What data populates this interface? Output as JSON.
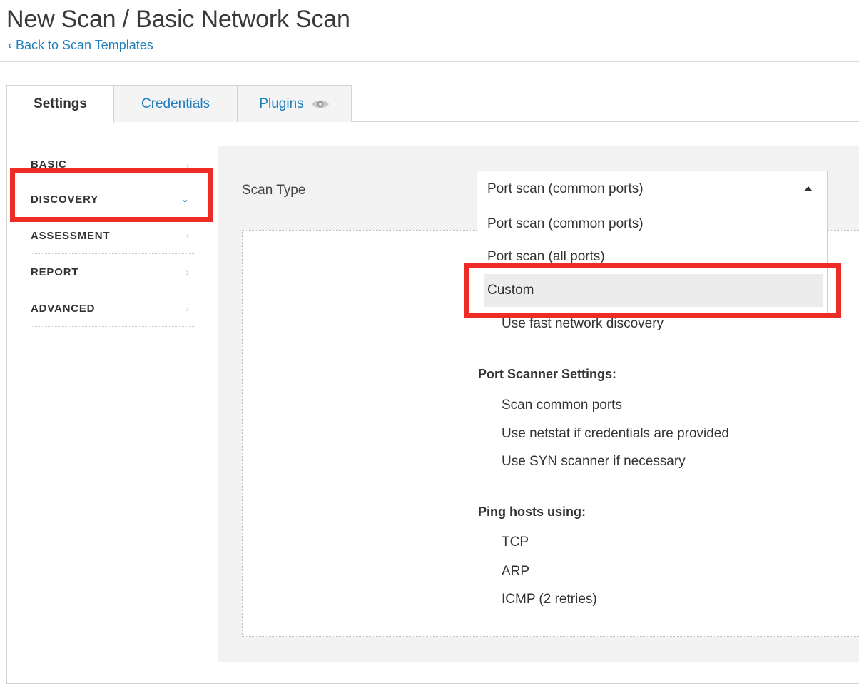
{
  "header": {
    "title": "New Scan / Basic Network Scan",
    "back_link": "Back to Scan Templates"
  },
  "tabs": [
    {
      "label": "Settings",
      "active": true
    },
    {
      "label": "Credentials",
      "active": false
    },
    {
      "label": "Plugins",
      "active": false,
      "icon": "eye-icon"
    }
  ],
  "nav": {
    "items": [
      {
        "label": "BASIC",
        "arrow": "›"
      },
      {
        "label": "DISCOVERY",
        "arrow": "⌄",
        "active": true
      },
      {
        "label": "ASSESSMENT",
        "arrow": "›"
      },
      {
        "label": "REPORT",
        "arrow": "›"
      },
      {
        "label": "ADVANCED",
        "arrow": "›"
      }
    ]
  },
  "scan_type": {
    "label": "Scan Type",
    "selected": "Port scan (common ports)",
    "options": [
      "Port scan (common ports)",
      "Port scan (all ports)",
      "Custom"
    ],
    "highlighted_option": "Custom"
  },
  "summary": {
    "general_items": [
      "Use fast network discovery"
    ],
    "port_scanner": {
      "heading": "Port Scanner Settings:",
      "items": [
        "Scan common ports",
        "Use netstat if credentials are provided",
        "Use SYN scanner if necessary"
      ]
    },
    "ping_hosts": {
      "heading": "Ping hosts using:",
      "items": [
        "TCP",
        "ARP",
        "ICMP (2 retries)"
      ]
    }
  },
  "colors": {
    "link": "#1f7ebd",
    "highlight_annotation": "#ee2b24",
    "content_bg": "#f2f2f2"
  }
}
